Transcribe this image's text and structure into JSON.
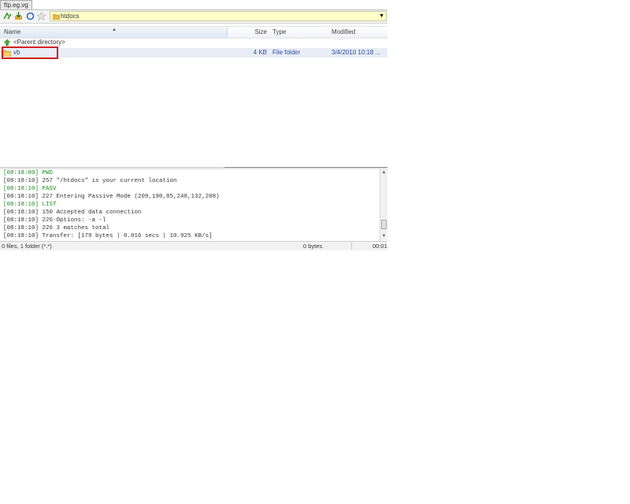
{
  "tab": {
    "label": "ftp.eg.vg"
  },
  "toolbar": {
    "buttons": [
      "up-dir-icon",
      "download-icon",
      "refresh-icon",
      "bookmark-icon"
    ],
    "address": {
      "value": "htdocs"
    }
  },
  "columns": {
    "name": "Name",
    "size": "Size",
    "type": "Type",
    "modified": "Modified"
  },
  "rows": [
    {
      "name": "<Parent directory>",
      "size": "",
      "type": "",
      "modified": "",
      "icon": "parent-dir-icon"
    },
    {
      "name": "vb",
      "size": "4 KB",
      "type": "File folder",
      "modified": "3/4/2010 10:18 ...",
      "icon": "folder-icon",
      "selected": true
    }
  ],
  "log": [
    {
      "time": "[08:18:09]",
      "text": "PWD",
      "kind": "command"
    },
    {
      "time": "[08:18:10]",
      "text": "257 \"/htdocs\" is your current location",
      "kind": "response"
    },
    {
      "time": "[08:18:10]",
      "text": "PASV",
      "kind": "command"
    },
    {
      "time": "[08:18:10]",
      "text": "227 Entering Passive Mode (209,190,85,248,132,208)",
      "kind": "response"
    },
    {
      "time": "[08:18:10]",
      "text": "LIST",
      "kind": "command"
    },
    {
      "time": "[08:18:10]",
      "text": "150 Accepted data connection",
      "kind": "response"
    },
    {
      "time": "[08:18:10]",
      "text": "226-Options: -a -l",
      "kind": "response"
    },
    {
      "time": "[08:18:10]",
      "text": "226 3 matches total",
      "kind": "response"
    },
    {
      "time": "[08:18:10]",
      "text": "Transfer: [179 bytes | 0.016 secs | 10.925 KB/s]",
      "kind": "response"
    }
  ],
  "status": {
    "left": "0 files, 1 folder (*.*)",
    "middle": "0 bytes",
    "right": "00:01"
  },
  "colors": {
    "command": "#1a8a1a",
    "response": "#333333",
    "highlight": "#d02020",
    "address_bg": "#ffffc8"
  }
}
